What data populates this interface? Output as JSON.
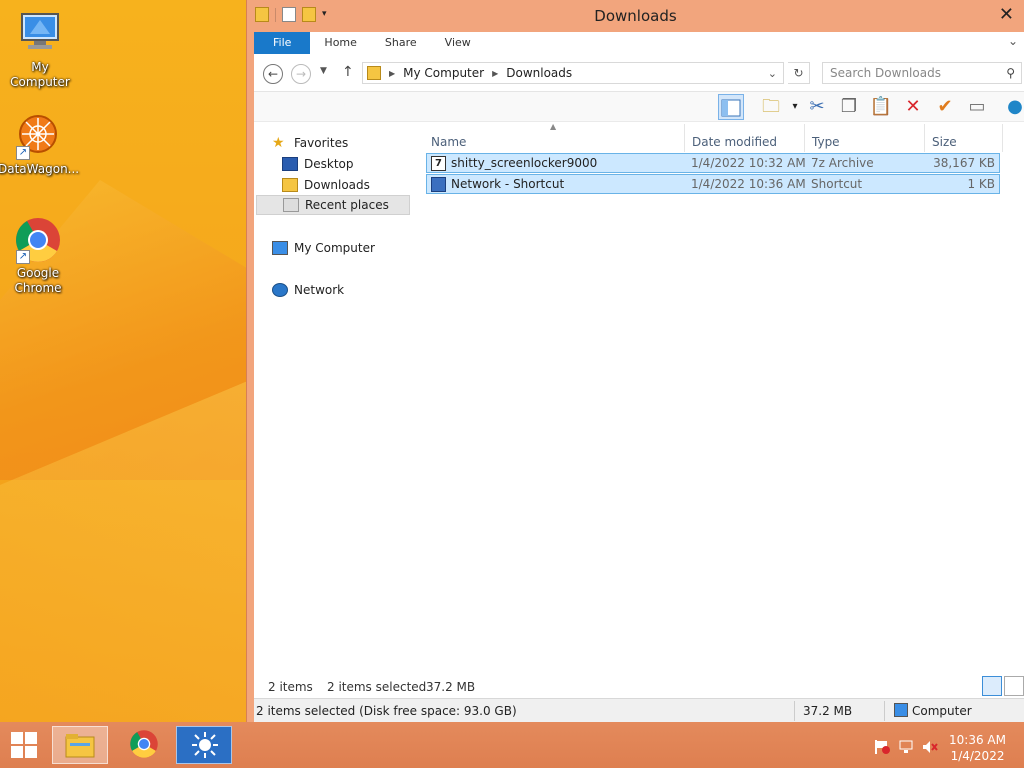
{
  "desktop": {
    "icons": [
      {
        "label": "My Computer"
      },
      {
        "label": "DataWagon..."
      },
      {
        "label": "Google\nChrome"
      }
    ]
  },
  "window": {
    "title": "Downloads",
    "ribbon_tabs": [
      "File",
      "Home",
      "Share",
      "View"
    ],
    "address": {
      "segments": [
        "My Computer",
        "Downloads"
      ]
    },
    "search_placeholder": "Search Downloads",
    "nav": {
      "favorites": "Favorites",
      "desktop": "Desktop",
      "downloads": "Downloads",
      "recent": "Recent places",
      "computer": "My Computer",
      "network": "Network"
    },
    "columns": {
      "name": "Name",
      "date": "Date modified",
      "type": "Type",
      "size": "Size"
    },
    "files": [
      {
        "name": "shitty_screenlocker9000",
        "date": "1/4/2022 10:32 AM",
        "type": "7z Archive",
        "size": "38,167 KB"
      },
      {
        "name": "Network - Shortcut",
        "date": "1/4/2022 10:36 AM",
        "type": "Shortcut",
        "size": "1 KB"
      }
    ],
    "status": {
      "count": "2 items",
      "selected": "2 items selected",
      "selected_size": "37.2 MB"
    },
    "details": {
      "text": "2 items selected (Disk free space: 93.0 GB)",
      "size": "37.2 MB",
      "location": "Computer"
    }
  },
  "taskbar": {
    "clock_time": "10:36 AM",
    "clock_date": "1/4/2022"
  },
  "colors": {
    "accent": "#1979ca",
    "selection": "#cce8ff",
    "window_frame": "#f2a57d"
  }
}
